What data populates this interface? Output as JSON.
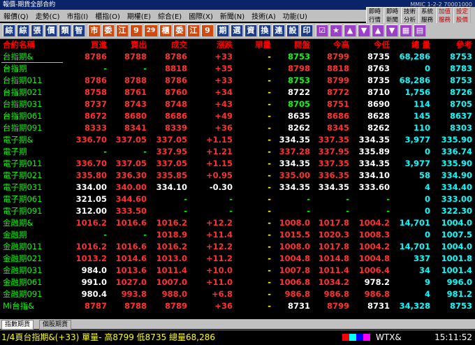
{
  "window": {
    "title": "報價-期貨全部合約",
    "right": "MMIC 1-2-2 70001000"
  },
  "menu": [
    "報價(Q)",
    "走勢(C)",
    "市指(I)",
    "櫃指(O)",
    "期權(E)",
    "綜合(E)",
    "國際(X)",
    "新聞(N)",
    "技術(A)",
    "功能(U)"
  ],
  "right_buttons": [
    {
      "l1": "即時",
      "l2": "行情",
      "red": false
    },
    {
      "l1": "即時",
      "l2": "新聞",
      "red": false
    },
    {
      "l1": "技術",
      "l2": "分析",
      "red": false
    },
    {
      "l1": "系統",
      "l2": "服務",
      "red": false
    },
    {
      "l1": "加值",
      "l2": "服務",
      "red": true
    },
    {
      "l1": "設定",
      "l2": "股價",
      "red": true
    }
  ],
  "toolbar": [
    {
      "t": "綜",
      "c": "blue"
    },
    {
      "t": "綜",
      "c": "blue"
    },
    {
      "t": "張",
      "c": "blue"
    },
    {
      "t": "價",
      "c": "blue"
    },
    {
      "t": "類",
      "c": "blue"
    },
    {
      "t": "智",
      "c": "blue"
    },
    {
      "t": "市",
      "c": "orange"
    },
    {
      "t": "委",
      "c": "orange"
    },
    {
      "t": "江",
      "c": "orange"
    },
    {
      "t": "9",
      "c": "orange"
    },
    {
      "t": "29",
      "c": "orange"
    },
    {
      "t": "櫃",
      "c": "orange"
    },
    {
      "t": "委",
      "c": "orange"
    },
    {
      "t": "江",
      "c": "orange"
    },
    {
      "t": "9",
      "c": "orange"
    },
    {
      "t": "期",
      "c": "blue"
    },
    {
      "t": "選",
      "c": "blue"
    },
    {
      "t": "資",
      "c": "blue"
    },
    {
      "t": "換",
      "c": "blue"
    },
    {
      "t": "連",
      "c": "blue"
    },
    {
      "t": "設",
      "c": "blue"
    },
    {
      "t": "印",
      "c": "blue"
    },
    {
      "t": "☑",
      "c": "purple"
    },
    {
      "t": "★",
      "c": "purple"
    },
    {
      "t": "▲",
      "c": "purple"
    },
    {
      "t": "▼",
      "c": "purple"
    },
    {
      "t": "▲",
      "c": "purple"
    },
    {
      "t": "▼",
      "c": "purple"
    },
    {
      "t": "▦",
      "c": "purple"
    },
    {
      "t": "▤",
      "c": "purple"
    }
  ],
  "headers": [
    "合約名稱",
    "買進",
    "賣出",
    "成交",
    "漲跌",
    "單量",
    "開盤",
    "今高",
    "今低",
    "總 量",
    "參考"
  ],
  "rows": [
    [
      "台指期&",
      "8786",
      "8788",
      "8786",
      "+33",
      "-",
      "8753",
      "8799",
      "8735",
      "68,286",
      "8753"
    ],
    [
      "台指期",
      "-",
      "-",
      "8818",
      "+35",
      "-",
      "8798",
      "8818",
      "8763",
      "0",
      "8783"
    ],
    [
      "台指期011",
      "8786",
      "8788",
      "8786",
      "+33",
      "-",
      "8753",
      "8799",
      "8735",
      "68,286",
      "8753"
    ],
    [
      "台指期021",
      "8758",
      "8761",
      "8760",
      "+34",
      "-",
      "8722",
      "8772",
      "8710",
      "1,756",
      "8726"
    ],
    [
      "台指期031",
      "8737",
      "8743",
      "8748",
      "+43",
      "-",
      "8705",
      "8751",
      "8690",
      "114",
      "8705"
    ],
    [
      "台指期061",
      "8672",
      "8680",
      "8686",
      "+49",
      "-",
      "8635",
      "8686",
      "8628",
      "145",
      "8637"
    ],
    [
      "台指期091",
      "8333",
      "8341",
      "8339",
      "+36",
      "-",
      "8262",
      "8345",
      "8262",
      "110",
      "8303"
    ],
    [
      "電子期&",
      "336.70",
      "337.05",
      "337.05",
      "+1.15",
      "-",
      "334.35",
      "337.35",
      "334.35",
      "3,977",
      "335.90"
    ],
    [
      "電子期",
      "-",
      "-",
      "337.95",
      "+1.21",
      "-",
      "337.28",
      "337.95",
      "335.89",
      "0",
      "336.74"
    ],
    [
      "電子期011",
      "336.70",
      "337.05",
      "337.05",
      "+1.15",
      "-",
      "334.35",
      "337.35",
      "334.35",
      "3,977",
      "335.90"
    ],
    [
      "電子期021",
      "335.80",
      "336.30",
      "335.85",
      "+0.95",
      "-",
      "335.00",
      "336.35",
      "334.10",
      "58",
      "334.90"
    ],
    [
      "電子期031",
      "334.00",
      "340.00",
      "334.10",
      "-0.30",
      "-",
      "334.35",
      "334.35",
      "333.60",
      "4",
      "334.40"
    ],
    [
      "電子期061",
      "321.05",
      "344.60",
      "-",
      "-",
      "-",
      "-",
      "-",
      "-",
      "0",
      "333.00"
    ],
    [
      "電子期091",
      "312.00",
      "333.50",
      "-",
      "-",
      "-",
      "-",
      "-",
      "-",
      "0",
      "322.30"
    ],
    [
      "金融期&",
      "1016.2",
      "1016.6",
      "1016.2",
      "+12.2",
      "-",
      "1008.0",
      "1017.8",
      "1004.2",
      "14,701",
      "1004.0"
    ],
    [
      "金融期",
      "-",
      "-",
      "1018.9",
      "+11.4",
      "-",
      "1015.5",
      "1020.3",
      "1008.3",
      "0",
      "1007.5"
    ],
    [
      "金融期011",
      "1016.2",
      "1016.6",
      "1016.2",
      "+12.2",
      "-",
      "1008.0",
      "1017.8",
      "1004.2",
      "14,701",
      "1004.0"
    ],
    [
      "金融期021",
      "1013.2",
      "1014.6",
      "1013.0",
      "+11.2",
      "-",
      "1004.8",
      "1014.8",
      "1004.8",
      "337",
      "1001.8"
    ],
    [
      "金融期031",
      "984.0",
      "1013.6",
      "1011.4",
      "+10.0",
      "-",
      "1007.8",
      "1011.4",
      "1006.4",
      "34",
      "1001.4"
    ],
    [
      "金融期061",
      "991.0",
      "1027.0",
      "1007.0",
      "+11.0",
      "-",
      "1006.8",
      "1034.2",
      "978.2",
      "9",
      "996.0"
    ],
    [
      "金融期091",
      "980.4",
      "993.8",
      "988.0",
      "+6.8",
      "-",
      "986.8",
      "986.8",
      "986.8",
      "4",
      "981.2"
    ],
    [
      "Mi台指&",
      "8787",
      "8788",
      "8789",
      "+36",
      "-",
      "8731",
      "8799",
      "8731",
      "34,328",
      "8753"
    ]
  ],
  "row_colors": [
    [
      "red",
      "red",
      "red",
      "red",
      "yel",
      "grn",
      "red",
      "wht",
      "cyan",
      "cyan"
    ],
    [
      "grn",
      "grn",
      "red",
      "red",
      "yel",
      "red",
      "red",
      "wht",
      "cyan",
      "cyan"
    ],
    [
      "red",
      "red",
      "red",
      "red",
      "yel",
      "grn",
      "red",
      "wht",
      "cyan",
      "cyan"
    ],
    [
      "red",
      "red",
      "red",
      "red",
      "yel",
      "wht",
      "red",
      "wht",
      "cyan",
      "cyan"
    ],
    [
      "red",
      "red",
      "red",
      "red",
      "yel",
      "grn",
      "red",
      "wht",
      "cyan",
      "cyan"
    ],
    [
      "red",
      "red",
      "red",
      "red",
      "yel",
      "wht",
      "red",
      "wht",
      "cyan",
      "cyan"
    ],
    [
      "red",
      "red",
      "red",
      "red",
      "yel",
      "wht",
      "red",
      "wht",
      "cyan",
      "cyan"
    ],
    [
      "red",
      "red",
      "red",
      "red",
      "yel",
      "wht",
      "red",
      "wht",
      "cyan",
      "cyan"
    ],
    [
      "grn",
      "grn",
      "red",
      "red",
      "yel",
      "red",
      "red",
      "wht",
      "cyan",
      "cyan"
    ],
    [
      "red",
      "red",
      "red",
      "red",
      "yel",
      "wht",
      "red",
      "wht",
      "cyan",
      "cyan"
    ],
    [
      "red",
      "red",
      "red",
      "red",
      "yel",
      "red",
      "red",
      "wht",
      "cyan",
      "cyan"
    ],
    [
      "wht",
      "red",
      "wht",
      "wht",
      "yel",
      "wht",
      "wht",
      "wht",
      "cyan",
      "cyan"
    ],
    [
      "wht",
      "red",
      "grn",
      "grn",
      "yel",
      "grn",
      "grn",
      "grn",
      "cyan",
      "cyan"
    ],
    [
      "wht",
      "red",
      "grn",
      "grn",
      "yel",
      "grn",
      "grn",
      "grn",
      "cyan",
      "cyan"
    ],
    [
      "red",
      "red",
      "red",
      "red",
      "yel",
      "red",
      "red",
      "red",
      "cyan",
      "cyan"
    ],
    [
      "grn",
      "grn",
      "red",
      "red",
      "yel",
      "red",
      "red",
      "red",
      "cyan",
      "cyan"
    ],
    [
      "red",
      "red",
      "red",
      "red",
      "yel",
      "red",
      "red",
      "red",
      "cyan",
      "cyan"
    ],
    [
      "red",
      "red",
      "red",
      "red",
      "yel",
      "red",
      "red",
      "red",
      "cyan",
      "cyan"
    ],
    [
      "wht",
      "red",
      "red",
      "red",
      "yel",
      "red",
      "red",
      "red",
      "cyan",
      "cyan"
    ],
    [
      "wht",
      "red",
      "red",
      "red",
      "yel",
      "red",
      "red",
      "wht",
      "cyan",
      "cyan"
    ],
    [
      "wht",
      "red",
      "red",
      "red",
      "yel",
      "red",
      "red",
      "red",
      "cyan",
      "cyan"
    ],
    [
      "red",
      "red",
      "red",
      "red",
      "yel",
      "wht",
      "red",
      "wht",
      "cyan",
      "cyan"
    ]
  ],
  "tabs": [
    "指數期貨",
    "個股期貨"
  ],
  "status": {
    "text": "1/4頁台指期&(+33) 單量- 高8799 低8735 總量68,286",
    "code": "WTX&",
    "time": "15:11:52"
  }
}
